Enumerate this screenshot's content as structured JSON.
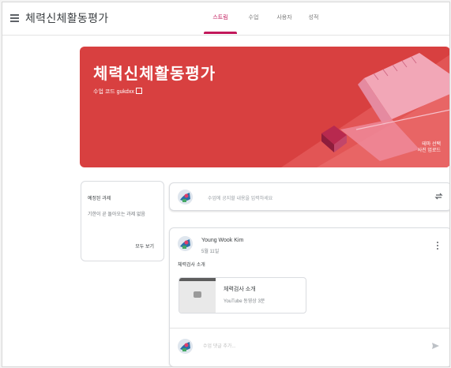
{
  "header": {
    "class_title": "체력신체활동평가",
    "tabs": [
      {
        "label": "스트림",
        "active": true
      },
      {
        "label": "수업",
        "active": false
      },
      {
        "label": "사용자",
        "active": false
      },
      {
        "label": "성적",
        "active": false
      }
    ]
  },
  "banner": {
    "title": "체력신체활동평가",
    "class_code_label": "수업 코드 gukdxx",
    "select_theme": "테마 선택",
    "upload_photo": "사진 업로드",
    "color": "#d84040"
  },
  "upcoming": {
    "title": "예정된 과제",
    "text": "기한이 곧 돌아오는 과제 없음",
    "view_all": "모두 보기"
  },
  "announce": {
    "placeholder": "수업에 공지할 내용을 입력하세요"
  },
  "post": {
    "author": "Young Wook Kim",
    "date": "5월 11일",
    "text": "체력검사 소개",
    "attachment": {
      "title": "체력검사 소개",
      "meta": "YouTube 동영상 3분"
    },
    "comment_placeholder": "수업 댓글 추가..."
  },
  "icons": [
    "menu-icon",
    "expand-icon",
    "repost-icon",
    "more-icon",
    "send-icon",
    "avatar"
  ],
  "colors": {
    "accent": "#c2185b",
    "banner": "#d84040"
  }
}
